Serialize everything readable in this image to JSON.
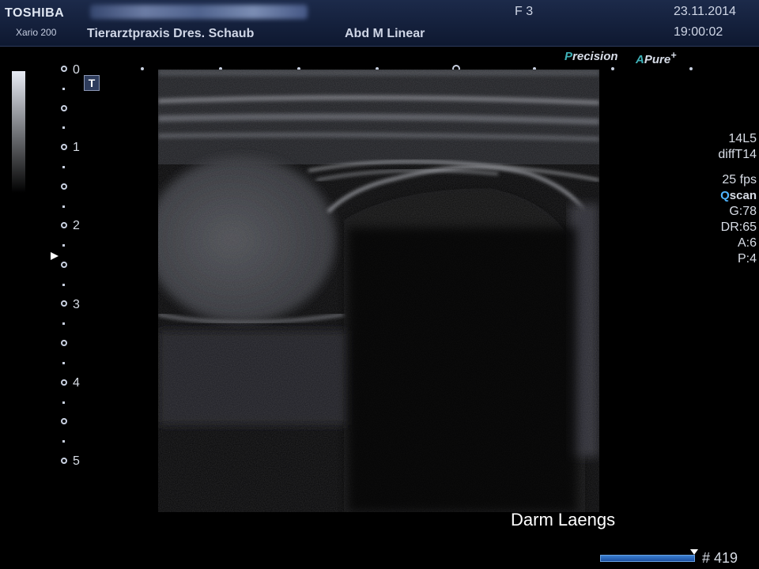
{
  "header": {
    "manufacturer": "TOSHIBA",
    "model": "Xario 200",
    "clinic": "Tierarztpraxis Dres. Schaub",
    "preset": "Abd M Linear",
    "frame": "F 3",
    "date": "23.11.2014",
    "time": "19:00:02"
  },
  "depth_scale": {
    "labels": [
      "0",
      "1",
      "2",
      "3",
      "4",
      "5"
    ]
  },
  "tool_button": {
    "label": "T"
  },
  "brands": {
    "precision_first": "P",
    "precision_rest": "recision",
    "apure_first": "A",
    "apure_rest": "Pure",
    "apure_plus": "+"
  },
  "params": {
    "probe": "14L5",
    "mode": "diffT14",
    "fps": "25 fps",
    "qscan_q": "Q",
    "qscan_rest": "scan",
    "gain": "G:78",
    "dynamic_range": "DR:65",
    "a": "A:6",
    "p": "P:4"
  },
  "annotation": "Darm Laengs",
  "cine": {
    "frame_count": "# 419"
  },
  "colors": {
    "header_bg": "#1c2a4a",
    "accent": "#3fb2b8",
    "cine": "#3b7fd0",
    "qscan_q": "#4fb4ff"
  }
}
